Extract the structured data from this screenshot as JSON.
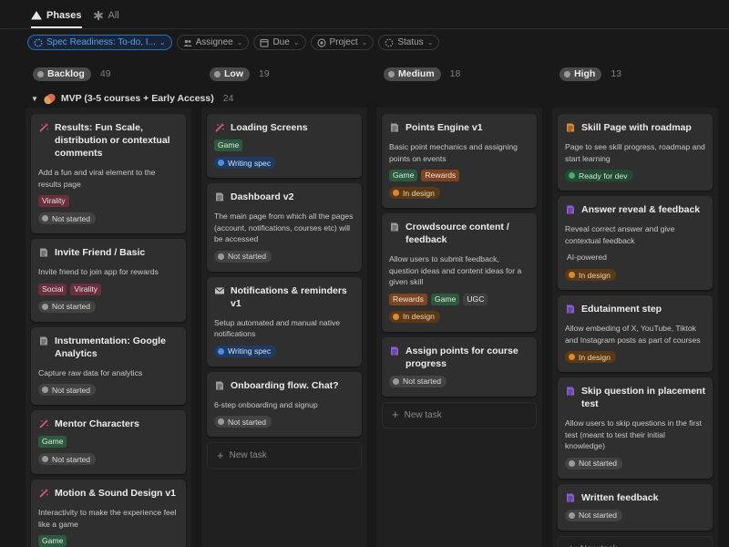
{
  "tabs": [
    {
      "label": "Phases",
      "icon": "phases-icon",
      "active": true
    },
    {
      "label": "All",
      "icon": "asterisk-icon",
      "active": false
    }
  ],
  "filters": [
    {
      "label": "Spec Readiness: To-do, I...",
      "icon": "dashed-circle-icon",
      "primary": true
    },
    {
      "label": "Assignee",
      "icon": "people-icon"
    },
    {
      "label": "Due",
      "icon": "calendar-icon"
    },
    {
      "label": "Project",
      "icon": "target-icon"
    },
    {
      "label": "Status",
      "icon": "status-icon"
    }
  ],
  "group": {
    "label": "MVP (3-5 courses + Early Access)",
    "count": "24"
  },
  "columns": [
    {
      "name": "Backlog",
      "count": "49",
      "cards": [
        {
          "title": "Results: Fun Scale, distribution or contextual comments",
          "icon": "wand-icon",
          "desc": "Add a fun and viral element to the results page",
          "tags": [
            {
              "label": "Virality",
              "kind": "virality"
            }
          ],
          "status": {
            "label": "Not started",
            "kind": "not"
          }
        },
        {
          "title": "Invite Friend / Basic",
          "icon": "doc-icon",
          "desc": "Invite friend to join app for rewards",
          "tags": [
            {
              "label": "Social",
              "kind": "social"
            },
            {
              "label": "Virality",
              "kind": "virality"
            }
          ],
          "status": {
            "label": "Not started",
            "kind": "not"
          }
        },
        {
          "title": "Instrumentation: Google Analytics",
          "icon": "doc-icon",
          "desc": "Capture raw data for analytics",
          "tags": [],
          "status": {
            "label": "Not started",
            "kind": "not"
          }
        },
        {
          "title": "Mentor Characters",
          "icon": "wand-icon",
          "desc": "",
          "tags": [
            {
              "label": "Game",
              "kind": "game"
            }
          ],
          "status": {
            "label": "Not started",
            "kind": "not"
          }
        },
        {
          "title": "Motion & Sound Design v1",
          "icon": "wand-icon",
          "desc": "Interactivity to make the experience feel like a game",
          "tags": [
            {
              "label": "Game",
              "kind": "game"
            }
          ],
          "status": null
        }
      ]
    },
    {
      "name": "Low",
      "count": "19",
      "cards": [
        {
          "title": "Loading Screens",
          "icon": "wand-icon",
          "desc": "",
          "tags": [
            {
              "label": "Game",
              "kind": "game"
            }
          ],
          "status": {
            "label": "Writing spec",
            "kind": "spec"
          }
        },
        {
          "title": "Dashboard v2",
          "icon": "doc-icon",
          "desc": "The main page from which all the pages (account, notifications, courses etc) will be accessed",
          "tags": [],
          "status": {
            "label": "Not started",
            "kind": "not"
          }
        },
        {
          "title": "Notifications & reminders v1",
          "icon": "mail-icon",
          "desc": "Setup automated and manual native notifications",
          "tags": [],
          "status": {
            "label": "Writing spec",
            "kind": "spec"
          }
        },
        {
          "title": "Onboarding flow. Chat?",
          "icon": "doc-icon",
          "desc": "6-step onboarding and signup",
          "tags": [],
          "status": {
            "label": "Not started",
            "kind": "not"
          }
        }
      ],
      "new_task": "New task"
    },
    {
      "name": "Medium",
      "count": "18",
      "cards": [
        {
          "title": "Points Engine v1",
          "icon": "doc-icon",
          "desc": "Basic point mechanics and assigning points on events",
          "tags": [
            {
              "label": "Game",
              "kind": "game"
            },
            {
              "label": "Rewards",
              "kind": "rewards"
            }
          ],
          "status": {
            "label": "In design",
            "kind": "design"
          }
        },
        {
          "title": "Crowdsource content / feedback",
          "icon": "doc-icon",
          "desc": "Allow users to submit feedback, question ideas and content ideas for a given skill",
          "tags": [
            {
              "label": "Rewards",
              "kind": "rewards"
            },
            {
              "label": "Game",
              "kind": "game"
            },
            {
              "label": "UGC",
              "kind": "ugc"
            }
          ],
          "status": {
            "label": "In design",
            "kind": "design"
          }
        },
        {
          "title": "Assign points for course progress",
          "icon": "purple-doc-icon",
          "desc": "",
          "tags": [],
          "status": {
            "label": "Not started",
            "kind": "not"
          }
        }
      ],
      "new_task": "New task"
    },
    {
      "name": "High",
      "count": "13",
      "cards": [
        {
          "title": "Skill Page with roadmap",
          "icon": "orange-doc-icon",
          "desc": "Page to see skill progress, roadmap and start learning",
          "tags": [],
          "status": {
            "label": "Ready for dev",
            "kind": "ready"
          }
        },
        {
          "title": "Answer reveal & feedback",
          "icon": "purple-doc-icon",
          "desc": "Reveal correct answer and give contextual feedback",
          "tags": [
            {
              "label": "AI-powered",
              "kind": "plain"
            }
          ],
          "status": {
            "label": "In design",
            "kind": "design"
          }
        },
        {
          "title": "Edutainment step",
          "icon": "purple-doc-icon",
          "desc": "Allow embeding of X, YouTube, Tiktok and Instagram posts as part of courses",
          "tags": [],
          "status": {
            "label": "In design",
            "kind": "design"
          }
        },
        {
          "title": "Skip question in placement test",
          "icon": "purple-doc-icon",
          "desc": "Allow users to skip questions in the first test (meant to test their initial knowledge)",
          "tags": [],
          "status": {
            "label": "Not started",
            "kind": "not"
          }
        },
        {
          "title": "Written feedback",
          "icon": "purple-doc-icon",
          "desc": "",
          "tags": [],
          "status": {
            "label": "Not started",
            "kind": "not"
          }
        }
      ],
      "new_task": "New task"
    }
  ]
}
